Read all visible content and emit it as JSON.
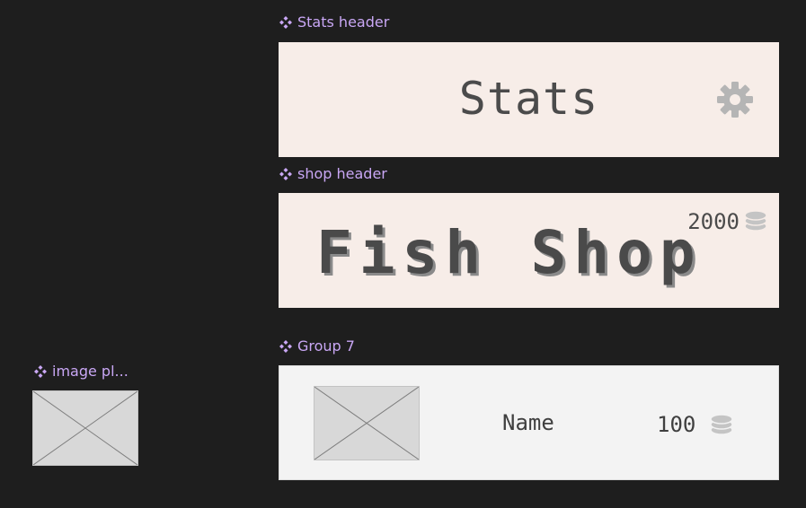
{
  "labels": {
    "stats_header": "Stats header",
    "shop_header": "shop header",
    "group7": "Group 7",
    "image_placeholder": "image pl..."
  },
  "stats": {
    "title": "Stats"
  },
  "shop": {
    "title": "Fish Shop",
    "coins": "2000"
  },
  "item": {
    "name": "Name",
    "price": "100"
  },
  "icons": {
    "component": "component-diamond-icon",
    "settings": "gear-icon",
    "coins": "coin-stack-icon",
    "image": "image-placeholder-icon"
  },
  "colors": {
    "canvas": "#1e1e1e",
    "label": "#c9a7f5",
    "peach_bg": "#f7ede8",
    "card_bg": "#f3f3f3"
  }
}
